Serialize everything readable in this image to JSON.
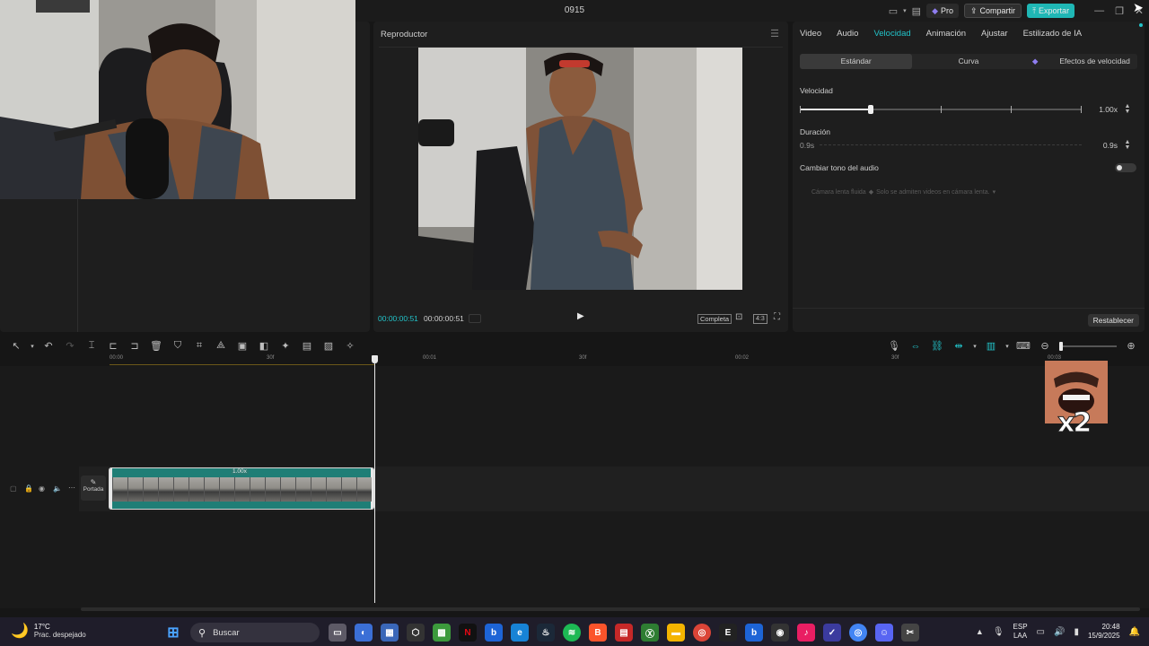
{
  "window": {
    "title": "0915"
  },
  "titlebar": {
    "pro_label": "Pro",
    "share_label": "Compartir",
    "export_label": "Exportar"
  },
  "player": {
    "title": "Reproductor",
    "current_time": "00:00:00:51",
    "total_time": "00:00:00:51",
    "full_label": "Completa",
    "ratio_label": "4:3"
  },
  "properties": {
    "tabs": [
      {
        "label": "Video",
        "active": false
      },
      {
        "label": "Audio",
        "active": false
      },
      {
        "label": "Velocidad",
        "active": true
      },
      {
        "label": "Animación",
        "active": false
      },
      {
        "label": "Ajustar",
        "active": false
      },
      {
        "label": "Estilizado de IA",
        "active": false
      }
    ],
    "modes": {
      "standard": "Estándar",
      "curve": "Curva",
      "effects": "Efectos de velocidad"
    },
    "speed_label": "Velocidad",
    "speed_value": "1.00x",
    "speed_level": 0.25,
    "duration_label": "Duración",
    "duration_start": "0.9s",
    "duration_value": "0.9s",
    "pitch_label": "Cambiar tono del audio",
    "pitch_enabled": false,
    "slowmo_label": "Cámara lenta fluida",
    "slowmo_note": "Solo se admiten videos en cámara lenta.",
    "reset_label": "Restablecer"
  },
  "timeline": {
    "ruler": [
      "00:00",
      "30f",
      "00:01",
      "30f",
      "00:02",
      "30f",
      "00:03"
    ],
    "clip_speed": "1.00x",
    "cover_label": "Portada",
    "sticker_text": "x2"
  },
  "taskbar": {
    "weather_temp": "17°C",
    "weather_desc": "Prac. despejado",
    "search_placeholder": "Buscar",
    "lang_1": "ESP",
    "lang_2": "LAA",
    "time": "20:48",
    "date": "15/9/2025"
  },
  "colors": {
    "accent": "#22c3c9",
    "clip": "#1f7e76",
    "export": "#1fb7b5",
    "pro": "#6b5bd6"
  }
}
